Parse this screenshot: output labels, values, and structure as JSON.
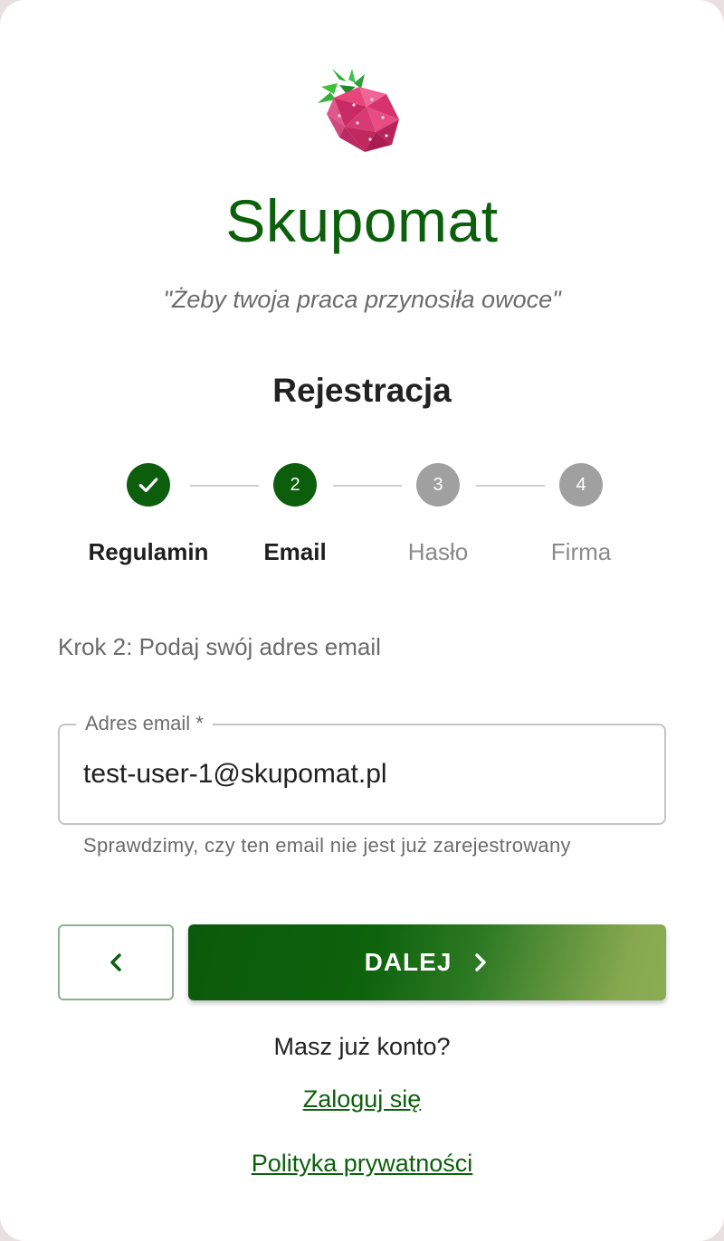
{
  "app": {
    "brand": "Skupomat",
    "tagline": "\"Żeby twoja praca przynosiła owoce\""
  },
  "page": {
    "title": "Rejestracja"
  },
  "stepper": {
    "steps": [
      {
        "number": "1",
        "label": "Regulamin",
        "state": "done"
      },
      {
        "number": "2",
        "label": "Email",
        "state": "active"
      },
      {
        "number": "3",
        "label": "Hasło",
        "state": "todo"
      },
      {
        "number": "4",
        "label": "Firma",
        "state": "todo"
      }
    ]
  },
  "form": {
    "instruction": "Krok 2: Podaj swój adres email",
    "email": {
      "label": "Adres email *",
      "value": "test-user-1@skupomat.pl",
      "helper": "Sprawdzimy, czy ten email nie jest już zarejestrowany"
    }
  },
  "actions": {
    "next_label": "DALEJ"
  },
  "footer": {
    "have_account": "Masz już konto?",
    "login_link": "Zaloguj się",
    "privacy_link": "Polityka prywatności"
  },
  "icons": {
    "logo": "strawberry-icon",
    "done": "check-icon",
    "back": "chevron-left-icon",
    "next": "chevron-right-icon"
  },
  "colors": {
    "brand_green": "#0c600c",
    "inactive_step": "#a0a0a0",
    "gradient_end": "#8aac52"
  }
}
